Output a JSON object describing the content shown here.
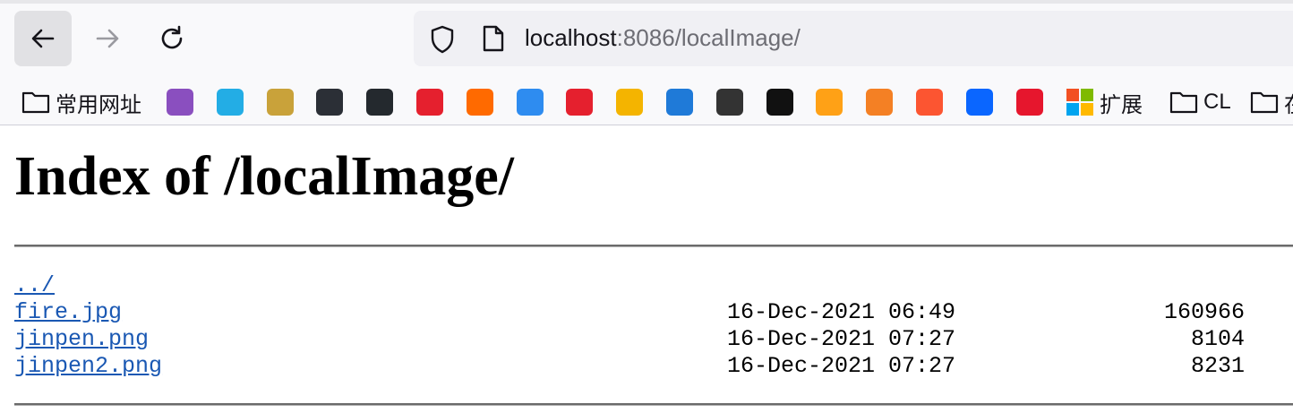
{
  "browser": {
    "url_host": "localhost",
    "url_rest": ":8086/localImage/"
  },
  "bookmarks": {
    "folder_label": "常用网址",
    "extensions_label": "扩展",
    "cl_label": "CL",
    "last_label": "在",
    "icons": [
      {
        "name": "purple-circle-icon",
        "color": "#8a4fbf"
      },
      {
        "name": "bilibili-icon",
        "color": "#23ade5"
      },
      {
        "name": "tiger-icon",
        "color": "#c9a23a"
      },
      {
        "name": "robot-icon",
        "color": "#2b2f36"
      },
      {
        "name": "github-icon",
        "color": "#24292e"
      },
      {
        "name": "g-red-icon",
        "color": "#e5202e"
      },
      {
        "name": "bracket-orange-icon",
        "color": "#ff6a00"
      },
      {
        "name": "cloud-icon",
        "color": "#2e8cf0"
      },
      {
        "name": "y-red-icon",
        "color": "#e5202e"
      },
      {
        "name": "colorful-circle-icon",
        "color": "#f4b400"
      },
      {
        "name": "graduation-icon",
        "color": "#1f7ad8"
      },
      {
        "name": "pen-icon",
        "color": "#333333"
      },
      {
        "name": "dark-circle-icon",
        "color": "#111111"
      },
      {
        "name": "leetcode-icon",
        "color": "#ffa116"
      },
      {
        "name": "stackoverflow-icon",
        "color": "#f48024"
      },
      {
        "name": "csdn-icon",
        "color": "#fc5531"
      },
      {
        "name": "zhihu-icon",
        "color": "#0a66ff"
      },
      {
        "name": "weibo-icon",
        "color": "#e6162d"
      },
      {
        "name": "microsoft-icon",
        "color": "#7fba00"
      }
    ]
  },
  "page": {
    "title": "Index of /localImage/",
    "entries": [
      {
        "name": "../",
        "date": "",
        "size": ""
      },
      {
        "name": "fire.jpg",
        "date": "16-Dec-2021 06:49",
        "size": "160966"
      },
      {
        "name": "jinpen.png",
        "date": "16-Dec-2021 07:27",
        "size": "8104"
      },
      {
        "name": "jinpen2.png",
        "date": "16-Dec-2021 07:27",
        "size": "8231"
      }
    ]
  },
  "colors": {
    "link": "#1a58b3",
    "chrome_bg": "#f9f9fb",
    "urlbar_bg": "#f0f0f4"
  }
}
